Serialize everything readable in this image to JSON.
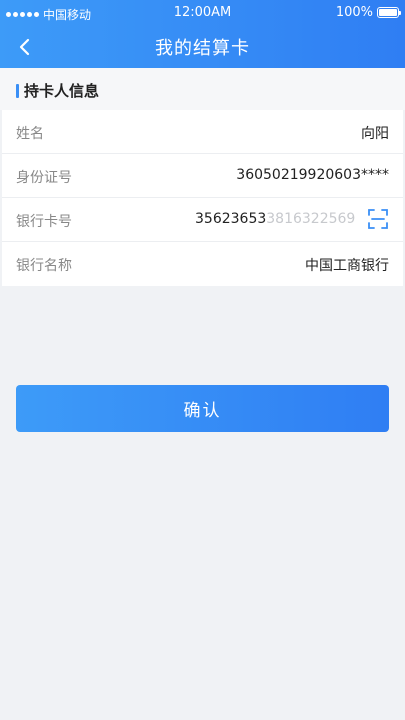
{
  "status_bar": {
    "carrier": "中国移动",
    "time": "12:00AM",
    "battery": "100%"
  },
  "nav": {
    "title": "我的结算卡"
  },
  "section": {
    "title": "持卡人信息"
  },
  "fields": [
    {
      "label": "姓名",
      "value": "向阳"
    },
    {
      "label": "身份证号",
      "value": "36050219920603****"
    },
    {
      "label": "银行卡号",
      "value": "35623653",
      "value_faded": "3816322569"
    },
    {
      "label": "银行名称",
      "value": "中国工商银行"
    }
  ],
  "actions": {
    "confirm_label": "确认"
  },
  "colors": {
    "accent": "#3a8ff6",
    "background": "#f0f2f5"
  }
}
